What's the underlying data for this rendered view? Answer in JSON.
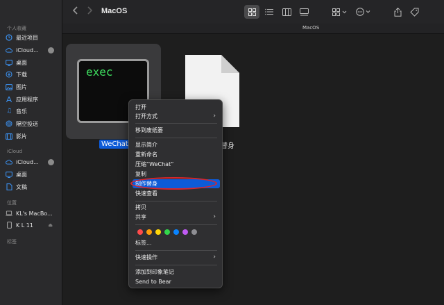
{
  "window": {
    "title": "MacOS",
    "path": "MacOS"
  },
  "sidebar": {
    "favorites_title": "个人收藏",
    "favorites": [
      {
        "label": "最近项目",
        "icon": "clock-icon"
      },
      {
        "label": "iCloud...",
        "icon": "cloud-icon"
      },
      {
        "label": "桌面",
        "icon": "desktop-icon"
      },
      {
        "label": "下载",
        "icon": "download-icon"
      },
      {
        "label": "图片",
        "icon": "photo-icon"
      },
      {
        "label": "应用程序",
        "icon": "apps-icon"
      },
      {
        "label": "音乐",
        "icon": "music-icon"
      },
      {
        "label": "隔空投送",
        "icon": "airdrop-icon"
      },
      {
        "label": "影片",
        "icon": "film-icon"
      }
    ],
    "icloud_title": "iCloud",
    "icloud": [
      {
        "label": "iCloud...",
        "icon": "cloud-icon"
      },
      {
        "label": "桌面",
        "icon": "folder-icon"
      },
      {
        "label": "文稿",
        "icon": "document-icon"
      }
    ],
    "locations_title": "位置",
    "locations": [
      {
        "label": "KL's MacBo...",
        "icon": "laptop-icon"
      },
      {
        "label": "K L 11",
        "icon": "phone-icon"
      }
    ],
    "tags_title": "标签"
  },
  "files": [
    {
      "name": "WeChat",
      "icon_text": "exec",
      "selected": true
    },
    {
      "name": "替身",
      "icon": "document-icon",
      "selected": false
    }
  ],
  "context_menu": {
    "groups": [
      [
        {
          "label": "打开"
        },
        {
          "label": "打开方式",
          "submenu": true
        }
      ],
      [
        {
          "label": "移到废纸篓"
        }
      ],
      [
        {
          "label": "显示简介"
        },
        {
          "label": "重新命名"
        },
        {
          "label": "压缩“WeChat”"
        },
        {
          "label": "复制"
        },
        {
          "label": "制作替身",
          "highlighted": true
        },
        {
          "label": "快速查看"
        }
      ],
      [
        {
          "label": "拷贝"
        },
        {
          "label": "共享",
          "submenu": true
        }
      ],
      [
        {
          "label": "标签..."
        }
      ],
      [
        {
          "label": "快速操作",
          "submenu": true
        }
      ],
      [
        {
          "label": "添加到印象笔记"
        },
        {
          "label": "Send to Bear"
        }
      ]
    ],
    "tag_colors": [
      "#ff4b4b",
      "#ff9f0a",
      "#ffd60a",
      "#32d74b",
      "#0a84ff",
      "#bf5af2",
      "#8e8e93"
    ]
  },
  "colors": {
    "accent": "#0d5bd8",
    "highlight_ring": "#d9262b"
  }
}
